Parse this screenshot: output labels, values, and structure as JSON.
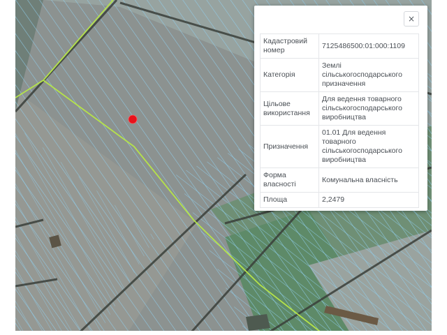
{
  "popup": {
    "close_label": "×",
    "rows": [
      {
        "label": "Кадастровий номер",
        "value": "7125486500:01:000:1109"
      },
      {
        "label": "Категорія",
        "value": "Землі сільськогосподарського призначення"
      },
      {
        "label": "Цільове використання",
        "value": "Для ведення товарного сільськогосподарського виробництва"
      },
      {
        "label": "Призначення",
        "value": "01.01 Для ведення товарного сільськогосподарського виробництва"
      },
      {
        "label": "Форма власності",
        "value": "Комунальна власність"
      },
      {
        "label": "Площа",
        "value": "2,2479"
      }
    ]
  },
  "map": {
    "marker": {
      "name": "selected-point-marker",
      "color": "#e8121b"
    },
    "parcel_line_color": "#8fd0f0",
    "boundary_line_color": "#b5e34a",
    "road_color": "#3a3f3a",
    "background_color": "#8c9290"
  }
}
